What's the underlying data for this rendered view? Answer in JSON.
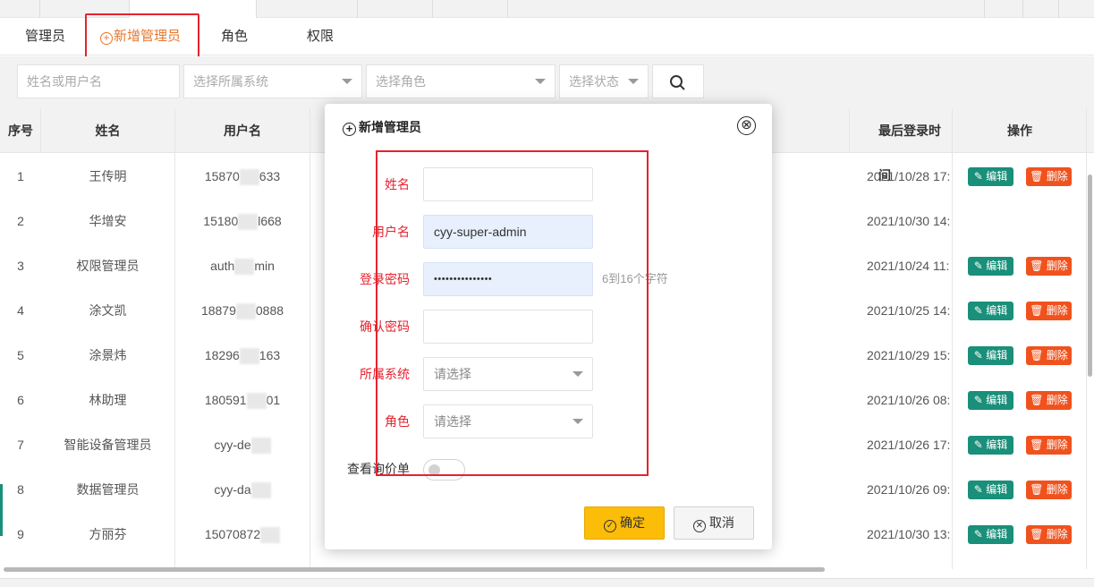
{
  "subtabs": {
    "admins": "管理员",
    "add_admin": "新增管理员",
    "roles": "角色",
    "permissions": "权限"
  },
  "filters": {
    "name_placeholder": "姓名或用户名",
    "system_placeholder": "选择所属系统",
    "role_placeholder": "选择角色",
    "status_placeholder": "选择状态"
  },
  "table": {
    "headers": {
      "index": "序号",
      "name": "姓名",
      "username": "用户名",
      "last_login": "最后登录时间",
      "actions": "操作"
    },
    "edit_label": "编辑",
    "delete_label": "删除",
    "rows": [
      {
        "index": "1",
        "name": "王传明",
        "user_a": "15870",
        "user_b": "633",
        "last_login": "2021/10/28 17:",
        "has_actions": true
      },
      {
        "index": "2",
        "name": "华增安",
        "user_a": "15180",
        "user_b": "l668",
        "last_login": "2021/10/30 14:",
        "has_actions": false
      },
      {
        "index": "3",
        "name": "权限管理员",
        "user_a": "auth",
        "user_b": "min",
        "last_login": "2021/10/24 11:",
        "has_actions": true
      },
      {
        "index": "4",
        "name": "涂文凯",
        "user_a": "18879",
        "user_b": "0888",
        "last_login": "2021/10/25 14:",
        "has_actions": true
      },
      {
        "index": "5",
        "name": "涂景炜",
        "user_a": "18296",
        "user_b": "163",
        "last_login": "2021/10/29 15:",
        "has_actions": true
      },
      {
        "index": "6",
        "name": "林助理",
        "user_a": "180591",
        "user_b": "01",
        "last_login": "2021/10/26 08:",
        "has_actions": true
      },
      {
        "index": "7",
        "name": "智能设备管理员",
        "user_a": "cyy-de",
        "user_b": "",
        "last_login": "2021/10/26 17:",
        "has_actions": true
      },
      {
        "index": "8",
        "name": "数据管理员",
        "user_a": "cyy-da",
        "user_b": "",
        "last_login": "2021/10/26 09:",
        "has_actions": true
      },
      {
        "index": "9",
        "name": "方丽芬",
        "user_a": "15070872",
        "user_b": "",
        "last_login": "2021/10/30 13:",
        "has_actions": true
      }
    ]
  },
  "modal": {
    "title": "新增管理员",
    "close_symbol": "⊗",
    "fields": {
      "name_label": "姓名",
      "name_value": "",
      "username_label": "用户名",
      "username_value": "cyy-super-admin",
      "password_label": "登录密码",
      "password_value": "•••••••••••••••",
      "password_hint": "6到16个字符",
      "confirm_label": "确认密码",
      "confirm_value": "",
      "system_label": "所属系统",
      "system_value": "请选择",
      "role_label": "角色",
      "role_value": "请选择",
      "quote_label": "查看询价单",
      "quote_enabled": false
    },
    "confirm_button": "确定",
    "cancel_button": "取消"
  },
  "colors": {
    "accent_orange": "#e8772e",
    "annotation_red": "#e5232f",
    "edit_green": "#1a8f7a",
    "delete_orange": "#f0521e",
    "confirm_yellow": "#fbbd08"
  }
}
